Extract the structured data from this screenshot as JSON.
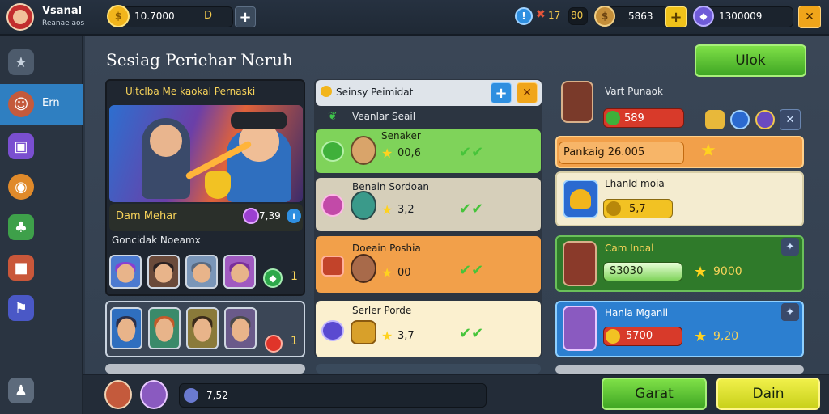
{
  "header": {
    "player_name": "Vsanal",
    "player_sub": "Reanae aos",
    "gold_value": "10.7000",
    "gold_tag": "D",
    "stat_a": "17",
    "stat_b": "80",
    "coins_value": "5863",
    "gems_value": "1300009",
    "close_label": "✕"
  },
  "sidebar": {
    "items": [
      {
        "icon": "star-icon",
        "label": ""
      },
      {
        "icon": "hero-icon",
        "label": "Ern"
      },
      {
        "icon": "puzzle-icon",
        "label": ""
      },
      {
        "icon": "shield-icon",
        "label": ""
      },
      {
        "icon": "leaf-icon",
        "label": ""
      },
      {
        "icon": "chest-icon",
        "label": ""
      },
      {
        "icon": "flag-icon",
        "label": ""
      }
    ]
  },
  "main": {
    "page_title": "Sesiag Periehar Neruh",
    "top_button": "Ulok",
    "featured": {
      "title": "Uitclba Me kaokal Pernaski",
      "caption": "Dam Mehar",
      "badge_value": "7,39",
      "team_label": "Goncidak Noeamx",
      "team_count": "1",
      "second_count": "1"
    },
    "list": {
      "header_title": "Seinsy Peimidat",
      "sub_title": "Veanlar Seail",
      "items": [
        {
          "name": "Senaker",
          "value": "00,6",
          "color": "#7fd35a"
        },
        {
          "name": "Benain Sordoan",
          "value": "3,2",
          "color": "#d6cfba"
        },
        {
          "name": "Doeain Poshia",
          "value": "00",
          "color": "#f2a04a"
        },
        {
          "name": "Serler Porde",
          "value": "3,7",
          "color": "#fbf0cf"
        }
      ]
    },
    "right": {
      "top_name": "Vart Punaok",
      "top_value": "589",
      "banner_label": "Pankaig 26.005",
      "card1_title": "Lhanld moia",
      "card1_value": "5,7",
      "card2_title": "Cam Inoal",
      "card2_value": "S3030",
      "card2_stars": "9000",
      "card3_title": "Hanla Mganil",
      "card3_value": "5700",
      "card3_stars": "9,20"
    }
  },
  "bottom": {
    "currency_value": "7,52",
    "btn_left": "Garat",
    "btn_right": "Dain"
  }
}
